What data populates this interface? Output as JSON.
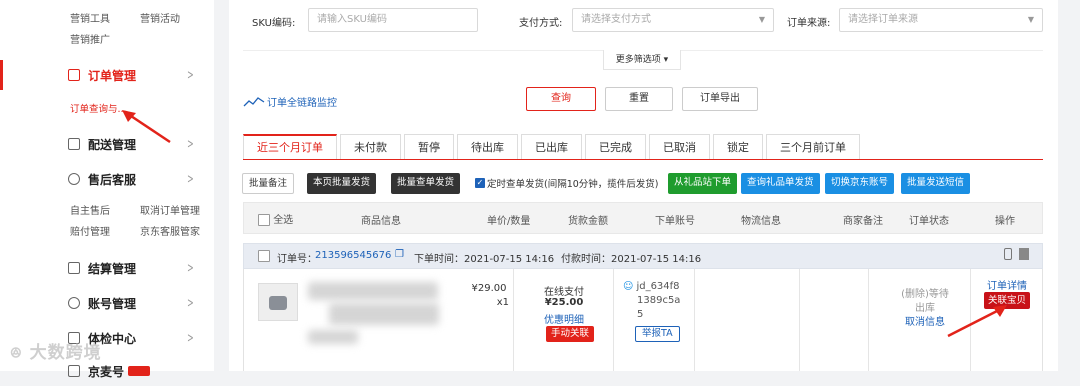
{
  "sidebar": {
    "marketing_row1": [
      "营销工具",
      "营销活动"
    ],
    "marketing_row2": [
      "营销推广"
    ],
    "order_mgmt": "订单管理",
    "order_query": "订单查询与...",
    "delivery": "配送管理",
    "after_sales": "售后客服",
    "after_row1": [
      "自主售后",
      "取消订单管理"
    ],
    "after_row2": [
      "赔付管理",
      "京东客服管家"
    ],
    "settlement": "结算管理",
    "account": "账号管理",
    "health": "体检中心",
    "last": "京麦号"
  },
  "filters": {
    "sku_label": "SKU编码:",
    "sku_placeholder": "请输入SKU编码",
    "pay_label": "支付方式:",
    "pay_placeholder": "请选择支付方式",
    "source_label": "订单来源:",
    "source_placeholder": "请选择订单来源",
    "more": "更多筛选项 ▾"
  },
  "monitor": "订单全链路监控",
  "actions": {
    "query": "查询",
    "reset": "重置",
    "export": "订单导出"
  },
  "tabs": [
    "近三个月订单",
    "未付款",
    "暂停",
    "待出库",
    "已出库",
    "已完成",
    "已取消",
    "锁定",
    "三个月前订单"
  ],
  "toolbar": {
    "batch_note": "批量备注",
    "batch_ship_page": "本页批量发货",
    "batch_ship_query": "批量查单发货",
    "timer_checkbox_label": "定时查单发货(间隔10分钟，揽件后发货)",
    "gift_order": "从礼品站下单",
    "gift_query": "查询礼品单发货",
    "switch_account": "切换京东账号",
    "batch_sms": "批量发送短信"
  },
  "table_head": [
    "全选",
    "商品信息",
    "单价/数量",
    "货款金额",
    "下单账号",
    "物流信息",
    "商家备注",
    "订单状态",
    "操作"
  ],
  "order": {
    "id_label": "订单号：",
    "id": "213596545676",
    "order_time": "下单时间：2021-07-15 14:16",
    "pay_time": "付款时间：2021-07-15 14:16",
    "price": "¥29.00",
    "qty": "x1",
    "pay_method": "在线支付",
    "amount": "¥25.00",
    "discount_detail": "优惠明细",
    "manual_link": "手动关联",
    "account_line1": "jd_634f8",
    "account_line2": "1389c5a",
    "account_line3": "5",
    "report": "举报TA",
    "status_line1": "(删除)等待",
    "status_line2": "出库",
    "cancel_info": "取消信息",
    "detail": "订单详情",
    "link_item": "关联宝贝"
  },
  "watermark": "大数跨境",
  "colors": {
    "accent": "#e2231a",
    "link": "#1e62b8",
    "green": "#1f9c2e",
    "blue": "#1a8fe3",
    "dark": "#333333"
  }
}
